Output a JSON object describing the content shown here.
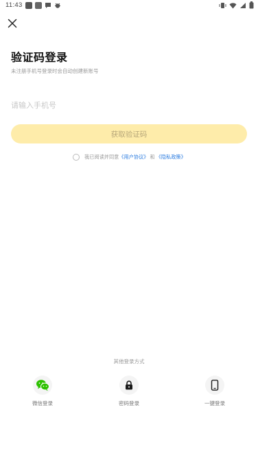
{
  "status_bar": {
    "time": "11:43"
  },
  "page": {
    "title": "验证码登录",
    "subtitle": "未注册手机号登录时会自动创建新账号"
  },
  "phone_field": {
    "placeholder": "请输入手机号",
    "value": ""
  },
  "primary_button": {
    "label": "获取验证码"
  },
  "agreement": {
    "prefix": "我已阅读并同意",
    "user_agreement": "《用户协议》",
    "conjunction": "和",
    "privacy_policy": "《隐私政策》",
    "checked": false
  },
  "other_login": {
    "title": "其他登录方式",
    "options": [
      {
        "label": "微信登录",
        "icon": "wechat-icon"
      },
      {
        "label": "密码登录",
        "icon": "lock-icon"
      },
      {
        "label": "一键登录",
        "icon": "phone-icon"
      }
    ]
  },
  "colors": {
    "button_bg": "#feecaa",
    "link": "#2d7de0",
    "wechat": "#2dc100"
  }
}
